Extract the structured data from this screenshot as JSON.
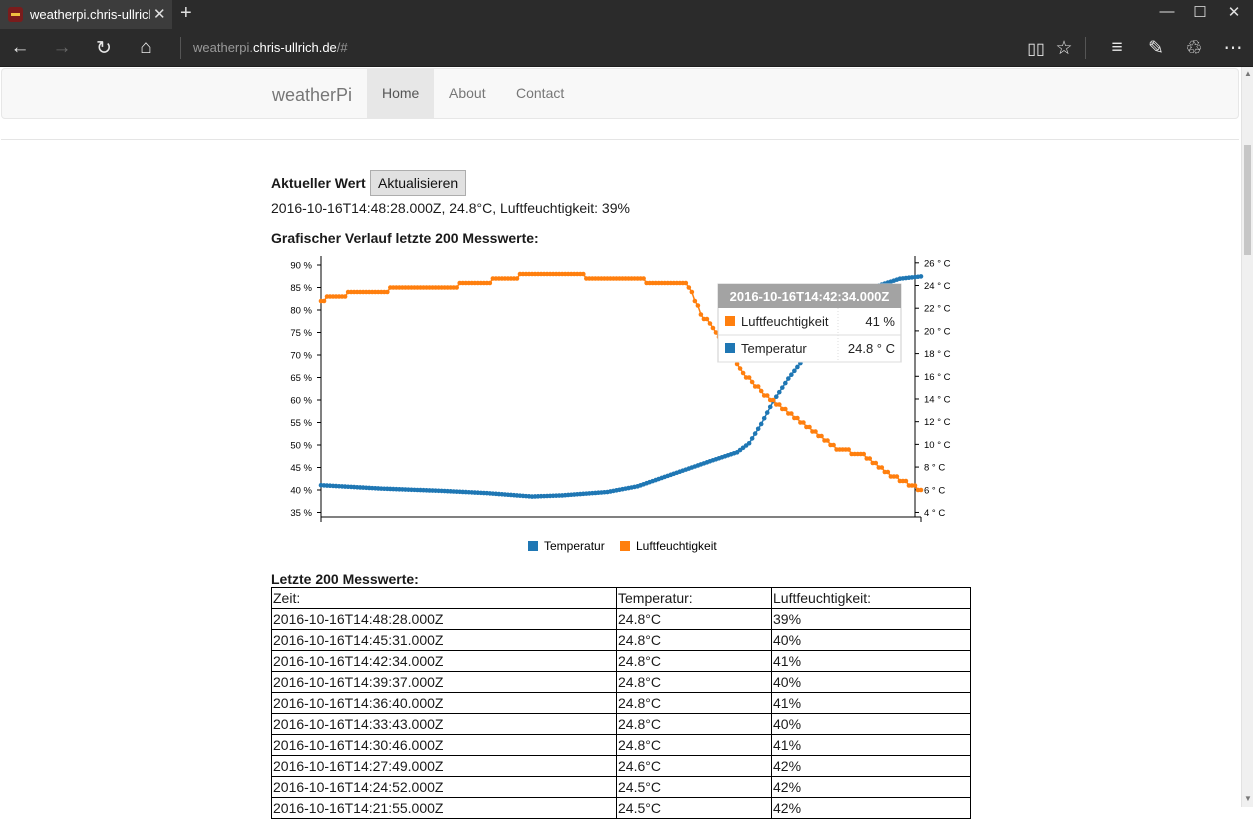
{
  "browser": {
    "tab_title": "weatherpi.chris-ullrich.de",
    "address_prefix": "weatherpi.",
    "address_host": "chris-ullrich.de",
    "address_suffix": "/#"
  },
  "navbar": {
    "brand": "weatherPi",
    "items": [
      {
        "label": "Home",
        "active": true
      },
      {
        "label": "About",
        "active": false
      },
      {
        "label": "Contact",
        "active": false
      }
    ]
  },
  "current": {
    "heading": "Aktueller Wert",
    "button": "Aktualisieren",
    "value": "2016-10-16T14:48:28.000Z, 24.8°C, Luftfeuchtigkeit: 39%"
  },
  "chart_heading": "Grafischer Verlauf letzte 200 Messwerte:",
  "chart_data": {
    "type": "line",
    "n_points": 200,
    "title": "",
    "left_axis": {
      "unit": "%",
      "ylim": [
        34,
        92
      ],
      "ticks": [
        35,
        40,
        45,
        50,
        55,
        60,
        65,
        70,
        75,
        80,
        85,
        90
      ],
      "tick_labels": [
        "35 %",
        "40 %",
        "45 %",
        "50 %",
        "55 %",
        "60 %",
        "65 %",
        "70 %",
        "75 %",
        "80 %",
        "85 %",
        "90 %"
      ]
    },
    "right_axis": {
      "unit": "° C",
      "ylim": [
        3.6,
        26.6
      ],
      "ticks": [
        4,
        6,
        8,
        10,
        12,
        14,
        16,
        18,
        20,
        22,
        24,
        26
      ],
      "tick_labels": [
        "4 ° C",
        "6 ° C",
        "8 ° C",
        "10 ° C",
        "12 ° C",
        "14 ° C",
        "16 ° C",
        "18 ° C",
        "20 ° C",
        "22 ° C",
        "24 ° C",
        "26 ° C"
      ]
    },
    "series": [
      {
        "name": "Temperatur",
        "axis": "right",
        "color": "#1f77b4",
        "keypoints": [
          [
            0,
            6.4
          ],
          [
            20,
            6.1
          ],
          [
            40,
            5.9
          ],
          [
            55,
            5.7
          ],
          [
            60,
            5.6
          ],
          [
            70,
            5.4
          ],
          [
            80,
            5.5
          ],
          [
            95,
            5.8
          ],
          [
            105,
            6.3
          ],
          [
            118,
            7.5
          ],
          [
            130,
            8.6
          ],
          [
            138,
            9.3
          ],
          [
            142,
            10.1
          ],
          [
            146,
            11.8
          ],
          [
            150,
            13.8
          ],
          [
            155,
            15.8
          ],
          [
            160,
            17.5
          ],
          [
            165,
            19.2
          ],
          [
            172,
            21.2
          ],
          [
            178,
            22.5
          ],
          [
            185,
            24.0
          ],
          [
            192,
            24.6
          ],
          [
            199,
            24.8
          ]
        ]
      },
      {
        "name": "Luftfeuchtigkeit",
        "axis": "left",
        "color": "#ff7f0e",
        "keypoints": [
          [
            0,
            82
          ],
          [
            3,
            83
          ],
          [
            15,
            84
          ],
          [
            30,
            85
          ],
          [
            40,
            85
          ],
          [
            52,
            86
          ],
          [
            62,
            87
          ],
          [
            70,
            88
          ],
          [
            85,
            88
          ],
          [
            90,
            87
          ],
          [
            105,
            87
          ],
          [
            110,
            86
          ],
          [
            120,
            86
          ],
          [
            122,
            85
          ],
          [
            124,
            82
          ],
          [
            126,
            79
          ],
          [
            130,
            76
          ],
          [
            134,
            72
          ],
          [
            140,
            66
          ],
          [
            146,
            62
          ],
          [
            153,
            58
          ],
          [
            158,
            56
          ],
          [
            165,
            52
          ],
          [
            172,
            49
          ],
          [
            178,
            48
          ],
          [
            182,
            47
          ],
          [
            187,
            44
          ],
          [
            193,
            42
          ],
          [
            199,
            40
          ]
        ]
      }
    ],
    "tooltip": {
      "title": "2016-10-16T14:42:34.000Z",
      "rows": [
        {
          "name": "Luftfeuchtigkeit",
          "value": "41 %",
          "color": "#ff7f0e"
        },
        {
          "name": "Temperatur",
          "value": "24.8 ° C",
          "color": "#1f77b4"
        }
      ]
    },
    "legend": {
      "position": "bottom-center",
      "entries": [
        {
          "label": "Temperatur",
          "color": "#1f77b4"
        },
        {
          "label": "Luftfeuchtigkeit",
          "color": "#ff7f0e"
        }
      ]
    }
  },
  "table_heading": "Letzte 200 Messwerte:",
  "table": {
    "headers": [
      "Zeit:",
      "Temperatur:",
      "Luftfeuchtigkeit:"
    ],
    "rows": [
      [
        "2016-10-16T14:48:28.000Z",
        "24.8°C",
        "39%"
      ],
      [
        "2016-10-16T14:45:31.000Z",
        "24.8°C",
        "40%"
      ],
      [
        "2016-10-16T14:42:34.000Z",
        "24.8°C",
        "41%"
      ],
      [
        "2016-10-16T14:39:37.000Z",
        "24.8°C",
        "40%"
      ],
      [
        "2016-10-16T14:36:40.000Z",
        "24.8°C",
        "41%"
      ],
      [
        "2016-10-16T14:33:43.000Z",
        "24.8°C",
        "40%"
      ],
      [
        "2016-10-16T14:30:46.000Z",
        "24.8°C",
        "41%"
      ],
      [
        "2016-10-16T14:27:49.000Z",
        "24.6°C",
        "42%"
      ],
      [
        "2016-10-16T14:24:52.000Z",
        "24.5°C",
        "42%"
      ],
      [
        "2016-10-16T14:21:55.000Z",
        "24.5°C",
        "42%"
      ]
    ]
  }
}
